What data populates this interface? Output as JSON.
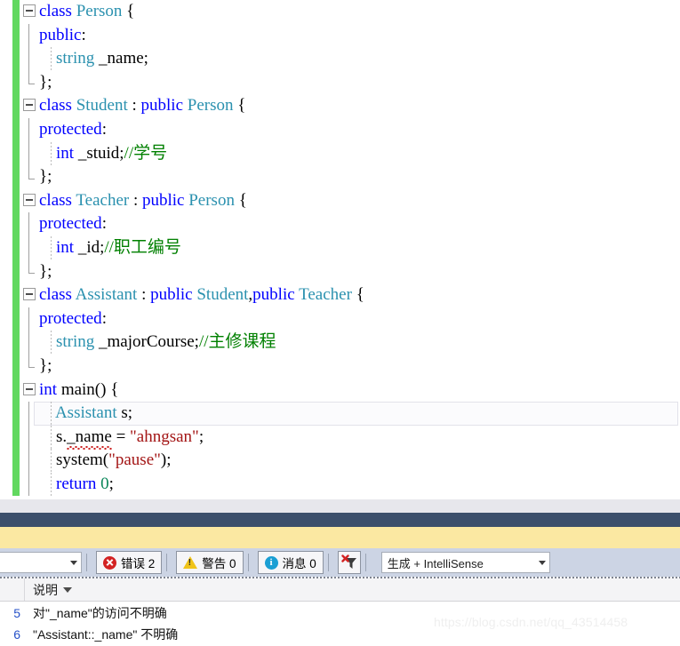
{
  "editor": {
    "language": "cpp",
    "change_bar_color": "#62d860",
    "colors": {
      "keyword": "#0000ff",
      "type": "#2b91af",
      "string": "#a31515",
      "comment": "#008000",
      "number": "#098658",
      "plain": "#000000",
      "error_squiggle": "#cc2222"
    },
    "current_line_index": 17,
    "lines": [
      {
        "text": "class Person {",
        "tokens": [
          {
            "t": "class",
            "c": "kw"
          },
          {
            "t": " ",
            "c": "plain"
          },
          {
            "t": "Person",
            "c": "type"
          },
          {
            "t": " {",
            "c": "plain"
          }
        ]
      },
      {
        "text": "public:",
        "tokens": [
          {
            "t": "public",
            "c": "kw"
          },
          {
            "t": ":",
            "c": "plain"
          }
        ]
      },
      {
        "text": "    string _name;",
        "tokens": [
          {
            "t": "    ",
            "c": "plain"
          },
          {
            "t": "string",
            "c": "type"
          },
          {
            "t": " _name;",
            "c": "plain"
          }
        ]
      },
      {
        "text": "};",
        "tokens": [
          {
            "t": "};",
            "c": "plain"
          }
        ]
      },
      {
        "text": "class Student : public Person {",
        "tokens": [
          {
            "t": "class",
            "c": "kw"
          },
          {
            "t": " ",
            "c": "plain"
          },
          {
            "t": "Student",
            "c": "type"
          },
          {
            "t": " : ",
            "c": "plain"
          },
          {
            "t": "public",
            "c": "kw"
          },
          {
            "t": " ",
            "c": "plain"
          },
          {
            "t": "Person",
            "c": "type"
          },
          {
            "t": " {",
            "c": "plain"
          }
        ]
      },
      {
        "text": "protected:",
        "tokens": [
          {
            "t": "protected",
            "c": "kw"
          },
          {
            "t": ":",
            "c": "plain"
          }
        ]
      },
      {
        "text": "    int _stuid;//学号",
        "tokens": [
          {
            "t": "    ",
            "c": "plain"
          },
          {
            "t": "int",
            "c": "kw"
          },
          {
            "t": " _stuid;",
            "c": "plain"
          },
          {
            "t": "//学号",
            "c": "cmt"
          }
        ]
      },
      {
        "text": "};",
        "tokens": [
          {
            "t": "};",
            "c": "plain"
          }
        ]
      },
      {
        "text": "class Teacher : public Person {",
        "tokens": [
          {
            "t": "class",
            "c": "kw"
          },
          {
            "t": " ",
            "c": "plain"
          },
          {
            "t": "Teacher",
            "c": "type"
          },
          {
            "t": " : ",
            "c": "plain"
          },
          {
            "t": "public",
            "c": "kw"
          },
          {
            "t": " ",
            "c": "plain"
          },
          {
            "t": "Person",
            "c": "type"
          },
          {
            "t": " {",
            "c": "plain"
          }
        ]
      },
      {
        "text": "protected:",
        "tokens": [
          {
            "t": "protected",
            "c": "kw"
          },
          {
            "t": ":",
            "c": "plain"
          }
        ]
      },
      {
        "text": "    int _id;//职工编号",
        "tokens": [
          {
            "t": "    ",
            "c": "plain"
          },
          {
            "t": "int",
            "c": "kw"
          },
          {
            "t": " _id;",
            "c": "plain"
          },
          {
            "t": "//职工编号",
            "c": "cmt"
          }
        ]
      },
      {
        "text": "};",
        "tokens": [
          {
            "t": "};",
            "c": "plain"
          }
        ]
      },
      {
        "text": "class Assistant : public Student,public Teacher {",
        "tokens": [
          {
            "t": "class",
            "c": "kw"
          },
          {
            "t": " ",
            "c": "plain"
          },
          {
            "t": "Assistant",
            "c": "type"
          },
          {
            "t": " : ",
            "c": "plain"
          },
          {
            "t": "public",
            "c": "kw"
          },
          {
            "t": " ",
            "c": "plain"
          },
          {
            "t": "Student",
            "c": "type"
          },
          {
            "t": ",",
            "c": "plain"
          },
          {
            "t": "public",
            "c": "kw"
          },
          {
            "t": " ",
            "c": "plain"
          },
          {
            "t": "Teacher",
            "c": "type"
          },
          {
            "t": " {",
            "c": "plain"
          }
        ]
      },
      {
        "text": "protected:",
        "tokens": [
          {
            "t": "protected",
            "c": "kw"
          },
          {
            "t": ":",
            "c": "plain"
          }
        ]
      },
      {
        "text": "    string _majorCourse;//主修课程",
        "tokens": [
          {
            "t": "    ",
            "c": "plain"
          },
          {
            "t": "string",
            "c": "type"
          },
          {
            "t": " _majorCourse;",
            "c": "plain"
          },
          {
            "t": "//主修课程",
            "c": "cmt"
          }
        ]
      },
      {
        "text": "};",
        "tokens": [
          {
            "t": "};",
            "c": "plain"
          }
        ]
      },
      {
        "text": "int main() {",
        "tokens": [
          {
            "t": "int",
            "c": "kw"
          },
          {
            "t": " main() {",
            "c": "plain"
          }
        ]
      },
      {
        "text": "    Assistant s;",
        "tokens": [
          {
            "t": "    ",
            "c": "plain"
          },
          {
            "t": "Assistant",
            "c": "type"
          },
          {
            "t": " s;",
            "c": "plain"
          }
        ]
      },
      {
        "text": "    s._name = \"ahngsan\";",
        "tokens": [
          {
            "t": "    s.",
            "c": "plain"
          },
          {
            "t": "_name",
            "c": "plain",
            "squiggle": true
          },
          {
            "t": " = ",
            "c": "plain"
          },
          {
            "t": "\"ahngsan\"",
            "c": "str"
          },
          {
            "t": ";",
            "c": "plain"
          }
        ]
      },
      {
        "text": "    system(\"pause\");",
        "tokens": [
          {
            "t": "    system(",
            "c": "plain"
          },
          {
            "t": "\"pause\"",
            "c": "str"
          },
          {
            "t": ");",
            "c": "plain"
          }
        ]
      },
      {
        "text": "    return 0;",
        "tokens": [
          {
            "t": "    ",
            "c": "plain"
          },
          {
            "t": "return",
            "c": "kw"
          },
          {
            "t": " ",
            "c": "plain"
          },
          {
            "t": "0",
            "c": "num"
          },
          {
            "t": ";",
            "c": "plain"
          }
        ]
      }
    ]
  },
  "bars": {
    "splitter_color": "#3c4f6b",
    "notification_strip_color": "#fbe8a2"
  },
  "error_list": {
    "toolbar": {
      "scope_combo_value": "",
      "scope_combo_placeholder": "",
      "error_toggle_label": "错误 2",
      "warning_toggle_label": "警告 0",
      "message_toggle_label": "消息 0",
      "clear_filter_tooltip": "清除筛选器",
      "build_filter_value": "生成 + IntelliSense"
    },
    "columns": [
      {
        "label": "说明",
        "sorted": true,
        "sort_direction": "desc"
      }
    ],
    "rows": [
      {
        "code": "5",
        "description": "对\"_name\"的访问不明确"
      },
      {
        "code": "6",
        "description": "\"Assistant::_name\" 不明确"
      }
    ]
  },
  "watermark": {
    "text": "https://blog.csdn.net/qq_43514458"
  }
}
